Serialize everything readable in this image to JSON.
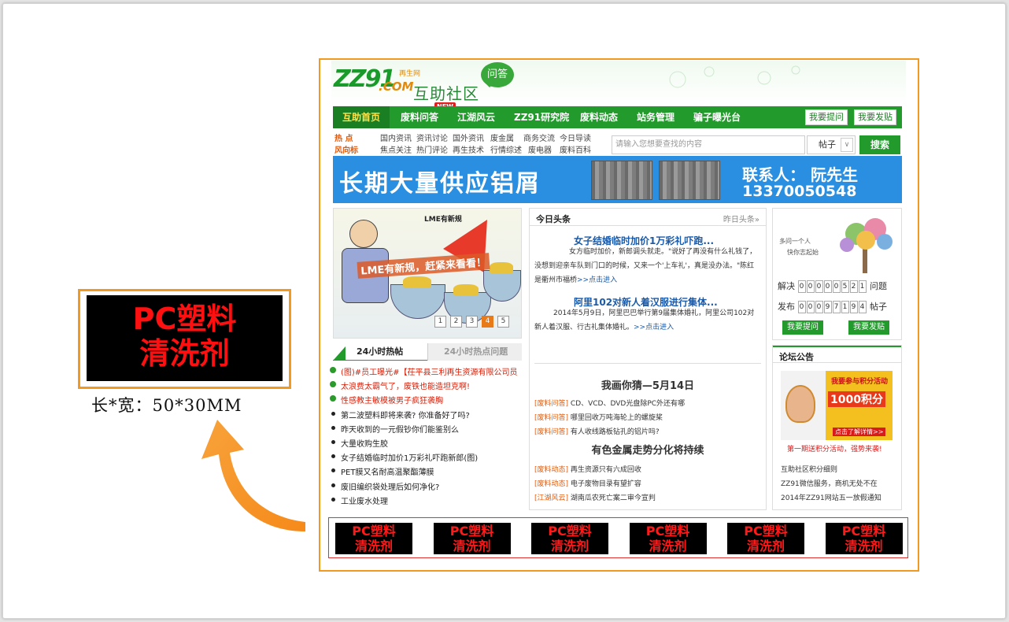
{
  "header": {
    "logo_main": "ZZ91",
    "logo_dotcom": ".COM",
    "logo_small": "再生网",
    "community": "互助社区",
    "bubble": "问答"
  },
  "nav": {
    "items": [
      "互助首页",
      "废料问答",
      "江湖风云",
      "ZZ91研究院",
      "废料动态",
      "站务管理",
      "骗子曝光台"
    ],
    "new_badge": "NEW",
    "btn_ask": "我要提问",
    "btn_post": "我要发贴"
  },
  "links": {
    "hot_tag": "热  点",
    "wind_tag": "风向标",
    "row1": [
      "国内资讯",
      "资讯讨论",
      "国外资讯",
      "废金属",
      "商务交流",
      "今日导读"
    ],
    "row2": [
      "焦点关注",
      "热门评论",
      "再生技术",
      "行情综述",
      "废电器",
      "废料百科"
    ]
  },
  "search": {
    "placeholder": "请输入您想要查找的内容",
    "select": "帖子",
    "arrow": "∨",
    "button": "搜索"
  },
  "banner": {
    "headline": "长期大量供应铝屑",
    "contact_label": "联系人： 阮先生",
    "phone": "13370050548"
  },
  "cartoon": {
    "label": "LME有新规",
    "caption": "LME有新规，赶紧来看看！",
    "pages": [
      "1",
      "2",
      "3",
      "4",
      "5"
    ],
    "active_page": "4"
  },
  "hot": {
    "tab1": "24小时热帖",
    "tab2": "24小时热点问题",
    "items": [
      {
        "t": "(图)#员工曝光#【茌平县三利再生资源有限公司员",
        "red": true
      },
      {
        "t": "太浪费太霸气了，废铁也能造坦克啊!",
        "red": true
      },
      {
        "t": "性感教主敏模被男子疯狂袭胸",
        "red": true
      },
      {
        "t": "第二波塑料即将来袭? 你准备好了吗?",
        "red": false
      },
      {
        "t": "昨天收到的一元假钞你们能鉴别么",
        "red": false
      },
      {
        "t": "大量收购生胶",
        "red": false
      },
      {
        "t": "女子结婚临时加价1万彩礼吓跑新郎(图)",
        "red": false
      },
      {
        "t": "PET膜又名耐高温聚酯薄膜",
        "red": false
      },
      {
        "t": "废旧编织袋处理后如何净化?",
        "red": false
      },
      {
        "t": "工业废水处理",
        "red": false
      }
    ]
  },
  "news": {
    "head": "今日头条",
    "yesterday": "昨日头条»",
    "a1_title": "女子结婚临时加价1万彩礼吓跑...",
    "a1_body": "女方临时加价，新郎调头就走。\"说好了再没有什么礼钱了，没想到迎亲车队到门口的时候，又来一个'上车礼'，真是没办法。\"陈红是衢州市福桥",
    "a1_more": ">>点击进入",
    "a2_title": "阿里102对新人着汉服进行集体...",
    "a2_body": "2014年5月9日，阿里巴巴举行第9届集体婚礼，阿里公司102对新人着汉服、行古礼集体婚礼。",
    "a2_more": ">>点击进入",
    "sec1": "我画你猜—5月14日",
    "list1": [
      {
        "cat": "[废料问答]",
        "t": "CD、VCD、DVD光盘除PC外还有哪"
      },
      {
        "cat": "[废料问答]",
        "t": "哪里回收万吨海轮上的螺旋桨"
      },
      {
        "cat": "[废料问答]",
        "t": "有人收线路板钻孔的铝片吗?"
      }
    ],
    "sec2": "有色金属走势分化将持续",
    "list2": [
      {
        "cat": "[废料动态]",
        "t": "再生资源只有六成回收"
      },
      {
        "cat": "[废料动态]",
        "t": "电子废物目录有望扩容"
      },
      {
        "cat": "[江湖风云]",
        "t": "湖南瓜农死亡案二审今宣判"
      }
    ]
  },
  "tree": {
    "motto1": "多问一个人",
    "motto2": "快你志起始",
    "solved_label": "解决",
    "solved_digits": [
      "0",
      "0",
      "0",
      "0",
      "0",
      "5",
      "2",
      "1"
    ],
    "solved_unit": "问题",
    "posted_label": "发布",
    "posted_digits": [
      "0",
      "0",
      "0",
      "9",
      "7",
      "1",
      "9",
      "4"
    ],
    "posted_unit": "帖子",
    "btn_ask": "我要提问",
    "btn_post": "我要发贴"
  },
  "forum": {
    "head": "论坛公告",
    "ad_line1": "我要参与积分活动",
    "ad_points": "1000积分",
    "ad_btn": "点击了解详情>>",
    "ad_caption": "第一期送积分活动，强势来袭!",
    "items": [
      "互助社区积分细则",
      "ZZ91微信服务，商机无处不在",
      "2014年ZZ91网站五一放假通知"
    ]
  },
  "strip": {
    "ad_line1": "PC塑料",
    "ad_line2": "清洗剂",
    "count": 6
  },
  "bigad": {
    "line1": "PC塑料",
    "line2": "清洗剂",
    "size": "长*宽：50*30MM"
  },
  "colors": {
    "green": "#229a2c",
    "orange": "#f29a20",
    "blue": "#2a8fe0",
    "red": "#ff1a1a"
  }
}
